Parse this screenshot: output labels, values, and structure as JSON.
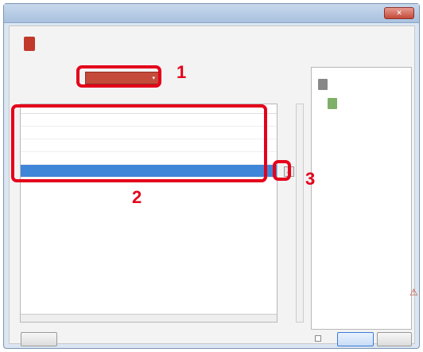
{
  "window": {
    "title": "",
    "close_glyph": "✕"
  },
  "header": {
    "title": "",
    "subtitle": ""
  },
  "form": {
    "dropdown_label": "",
    "dropdown_value": "",
    "list_label": ""
  },
  "list": {
    "columns": [
      "",
      ""
    ],
    "rows": [
      {
        "col1": "",
        "col2": ""
      },
      {
        "col1": "",
        "col2": ""
      },
      {
        "col1": "",
        "col2": ""
      },
      {
        "col1": "",
        "col2": ""
      },
      {
        "col1": "",
        "col2": "",
        "selected": true
      }
    ],
    "count_text": ""
  },
  "side_button": {
    "glyph": "…"
  },
  "right_panel": {
    "label": "",
    "item1": "",
    "item2": "",
    "checkbox_label": ""
  },
  "footer": {
    "left_button": "",
    "ok_button": "",
    "cancel_button": ""
  },
  "callouts": {
    "one": "1",
    "two": "2",
    "three": "3"
  },
  "colors": {
    "callout": "#e4001b",
    "selection": "#3f86d9",
    "accent_red": "#c44a3a"
  }
}
